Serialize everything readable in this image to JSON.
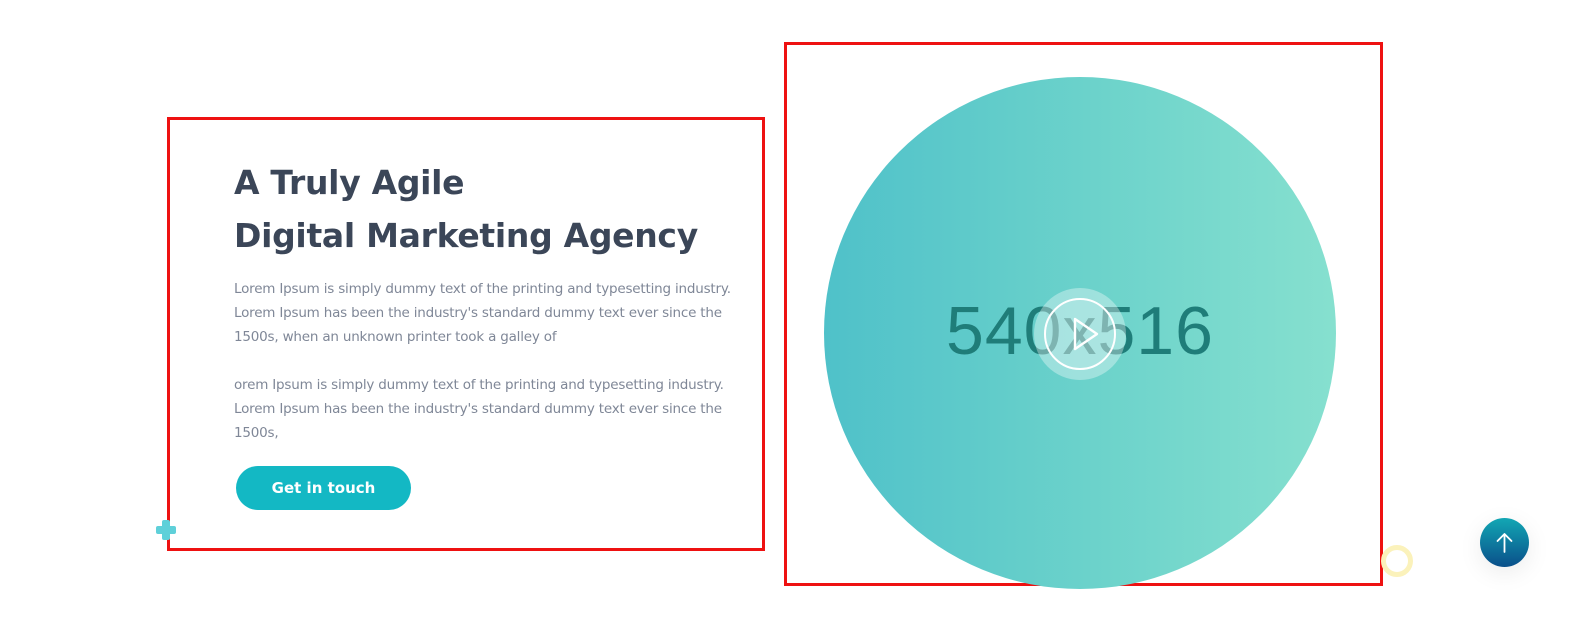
{
  "hero": {
    "heading_line1": "A Truly Agile",
    "heading_line2": "Digital Marketing Agency",
    "paragraph1": [
      "Lorem Ipsum is simply dummy text of the printing and typesetting industry.",
      "Lorem Ipsum has been the industry's standard dummy text ever since the",
      "1500s, when an unknown printer took a galley of"
    ],
    "paragraph2": [
      "orem Ipsum is simply dummy text of the printing and typesetting industry.",
      "Lorem Ipsum has been the industry's standard dummy text ever since the",
      "1500s,"
    ],
    "cta_label": "Get in touch"
  },
  "video": {
    "placeholder_text": "540x516",
    "play_icon": "play-icon"
  },
  "decor": {
    "plus_icon": "plus-icon",
    "ring_icon": "ring-icon"
  },
  "scroll_top": {
    "icon": "arrow-up-icon"
  },
  "colors": {
    "accent": "#13b8c4",
    "heading": "#3b4658",
    "body_text": "#7f8797",
    "annotation_box": "#ee1111",
    "video_gradient_start": "#4fc1c9",
    "video_gradient_end": "#86e0cf",
    "scroll_top_gradient_start": "#12a7b4",
    "scroll_top_gradient_end": "#0a4f8a"
  }
}
